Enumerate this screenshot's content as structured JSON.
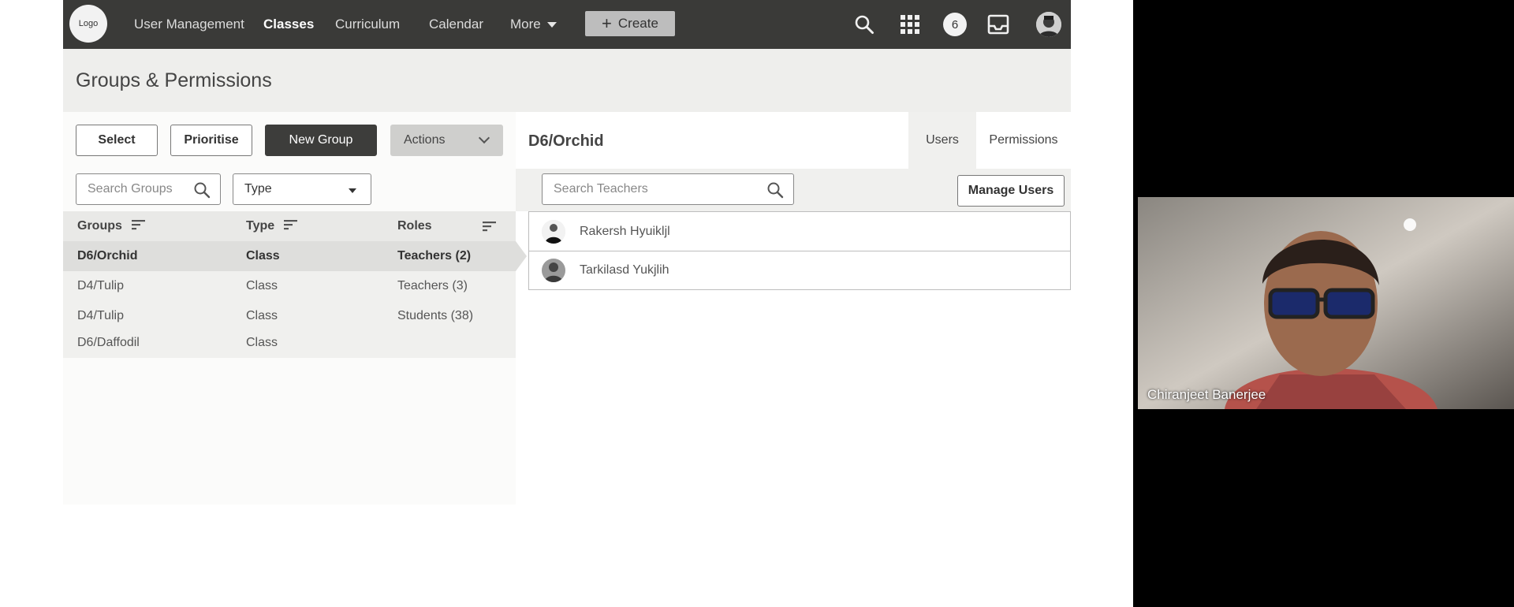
{
  "topbar": {
    "logo_text": "Logo",
    "nav": [
      "User Management",
      "Classes",
      "Curriculum",
      "Calendar",
      "More"
    ],
    "active_nav": "Classes",
    "create_label": "Create",
    "notification_count": "6",
    "icons": [
      "search-icon",
      "apps-grid-icon",
      "inbox-icon",
      "user-avatar"
    ]
  },
  "page": {
    "title": "Groups & Permissions"
  },
  "left": {
    "buttons": {
      "select": "Select",
      "prioritise": "Prioritise",
      "new_group": "New Group",
      "actions": "Actions"
    },
    "search": {
      "placeholder": "Search Groups"
    },
    "type_filter": "Type",
    "columns": [
      "Groups",
      "Type",
      "Roles"
    ],
    "rows": [
      {
        "group": "D6/Orchid",
        "type": "Class",
        "roles": "Teachers (2)",
        "selected": true
      },
      {
        "group": "D4/Tulip",
        "type": "Class",
        "roles": "Teachers (3)",
        "selected": false
      },
      {
        "group": "D4/Tulip",
        "type": "Class",
        "roles": "Students (38)",
        "selected": false
      },
      {
        "group": "D6/Daffodil",
        "type": "Class",
        "roles": "",
        "selected": false
      }
    ]
  },
  "right": {
    "title": "D6/Orchid",
    "tabs": [
      "Users",
      "Permissions"
    ],
    "active_tab": "Users",
    "search": {
      "placeholder": "Search Teachers"
    },
    "manage_label": "Manage Users",
    "users": [
      "Rakersh Hyuikljl",
      "Tarkilasd Yukjlih"
    ]
  },
  "video": {
    "participant_name": "Chiranjeet Banerjee"
  },
  "colors": {
    "topbar": "#3a3a38",
    "primary_button": "#3d3d3b",
    "selected_row": "#dededc",
    "video_background": "#000000"
  }
}
